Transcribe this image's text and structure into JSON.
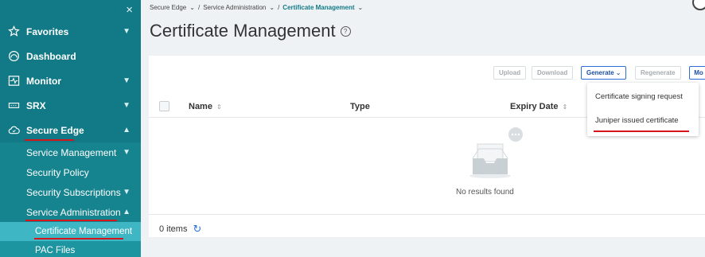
{
  "sidebar": {
    "close_glyph": "×",
    "items": [
      {
        "label": "Favorites",
        "icon": "star-icon"
      },
      {
        "label": "Dashboard",
        "icon": "dashboard-icon"
      },
      {
        "label": "Monitor",
        "icon": "monitor-icon"
      },
      {
        "label": "SRX",
        "icon": "srx-icon"
      },
      {
        "label": "Secure Edge",
        "icon": "cloud-icon"
      }
    ],
    "sub_items": [
      {
        "label": "Service Management"
      },
      {
        "label": "Security Policy"
      },
      {
        "label": "Security Subscriptions"
      },
      {
        "label": "Service Administration"
      }
    ],
    "subsub_items": [
      {
        "label": "Certificate Management"
      },
      {
        "label": "PAC Files"
      }
    ]
  },
  "breadcrumb": {
    "part1": "Secure Edge",
    "sep": "/",
    "part2": "Service Administration",
    "current": "Certificate Management"
  },
  "page": {
    "title": "Certificate Management",
    "help_glyph": "?"
  },
  "toolbar": {
    "upload": "Upload",
    "download": "Download",
    "generate": "Generate",
    "regenerate": "Regenerate",
    "more": "Mo"
  },
  "table": {
    "columns": [
      "Name",
      "Type",
      "Expiry Date"
    ],
    "sort_glyph": "⇕",
    "empty_text": "No results found"
  },
  "footer": {
    "items_count": "0 items"
  },
  "generate_menu": {
    "items": [
      "Certificate signing request",
      "Juniper issued certificate"
    ]
  },
  "colors": {
    "sidebar_bg": "#127a86",
    "active_item": "#3fb6c4",
    "accent": "#2b6fd6",
    "annotation": "#d4151a"
  }
}
